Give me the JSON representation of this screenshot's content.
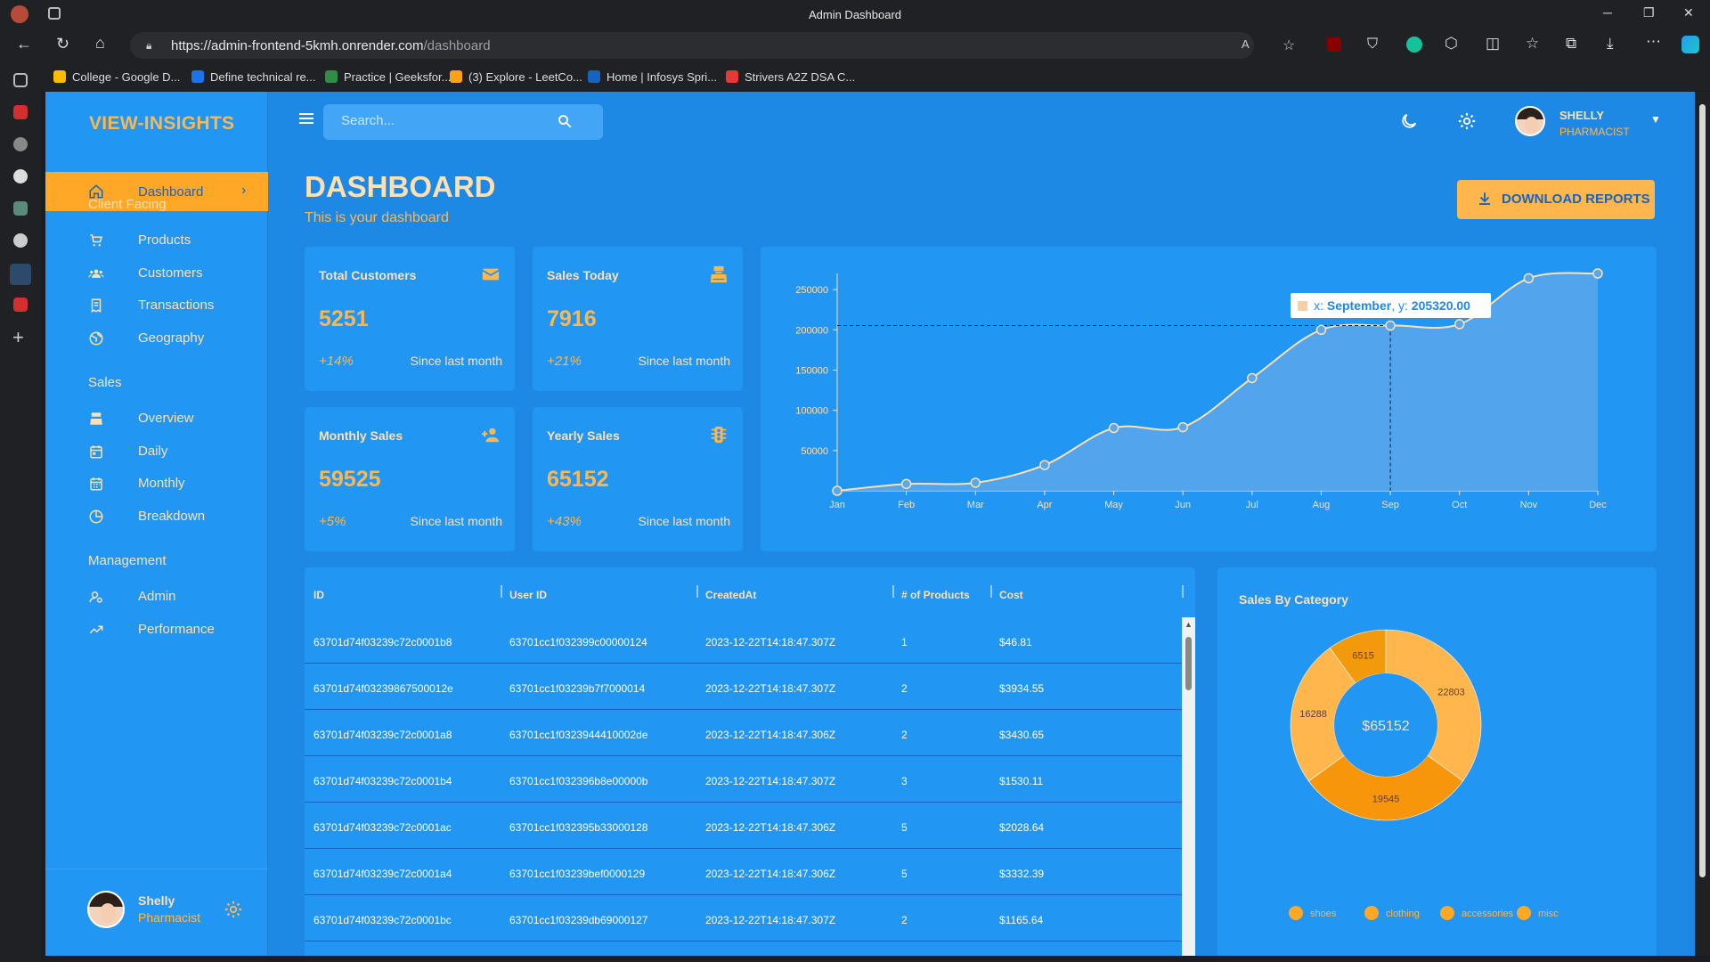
{
  "browser": {
    "window_title": "Admin Dashboard",
    "url_host": "https://admin-frontend-5kmh.onrender.com",
    "url_path": "/dashboard",
    "bookmarks": [
      {
        "label": "College - Google D...",
        "color": "#fbbc04"
      },
      {
        "label": "Define technical re...",
        "color": "#1a73e8"
      },
      {
        "label": "Practice | Geeksfor...",
        "color": "#2f8d46"
      },
      {
        "label": "(3) Explore - LeetCo...",
        "color": "#ffa116"
      },
      {
        "label": "Home | Infosys Spri...",
        "color": "#1565c0"
      },
      {
        "label": "Strivers A2Z DSA C...",
        "color": "#e53935"
      }
    ]
  },
  "sidebar": {
    "brand": "VIEW-INSIGHTS",
    "active": {
      "label": "Dashboard",
      "icon": "home-icon"
    },
    "sections": [
      {
        "title": "Client Facing",
        "items": [
          {
            "label": "Products",
            "icon": "cart-icon"
          },
          {
            "label": "Customers",
            "icon": "groups-icon"
          },
          {
            "label": "Transactions",
            "icon": "receipt-icon"
          },
          {
            "label": "Geography",
            "icon": "globe-icon"
          }
        ]
      },
      {
        "title": "Sales",
        "items": [
          {
            "label": "Overview",
            "icon": "point-of-sale-icon"
          },
          {
            "label": "Daily",
            "icon": "calendar-today-icon"
          },
          {
            "label": "Monthly",
            "icon": "calendar-month-icon"
          },
          {
            "label": "Breakdown",
            "icon": "pie-chart-icon"
          }
        ]
      },
      {
        "title": "Management",
        "items": [
          {
            "label": "Admin",
            "icon": "admin-icon"
          },
          {
            "label": "Performance",
            "icon": "trending-up-icon"
          }
        ]
      }
    ],
    "user": {
      "name": "Shelly",
      "role": "Pharmacist"
    }
  },
  "topbar": {
    "search_placeholder": "Search...",
    "user_name": "SHELLY",
    "user_role": "PHARMACIST"
  },
  "header": {
    "title": "DASHBOARD",
    "subtitle": "This is your dashboard",
    "download_label": "DOWNLOAD REPORTS"
  },
  "stats": [
    {
      "title": "Total Customers",
      "value": "5251",
      "increase": "+14%",
      "since": "Since last month",
      "icon": "email-icon"
    },
    {
      "title": "Sales Today",
      "value": "7916",
      "increase": "+21%",
      "since": "Since last month",
      "icon": "point-of-sale-icon"
    },
    {
      "title": "Monthly Sales",
      "value": "59525",
      "increase": "+5%",
      "since": "Since last month",
      "icon": "person-add-icon"
    },
    {
      "title": "Yearly Sales",
      "value": "65152",
      "increase": "+43%",
      "since": "Since last month",
      "icon": "traffic-icon"
    }
  ],
  "chart_data": [
    {
      "type": "area",
      "x": [
        "Jan",
        "Feb",
        "Mar",
        "Apr",
        "May",
        "Jun",
        "Jul",
        "Aug",
        "Sep",
        "Oct",
        "Nov",
        "Dec"
      ],
      "series": [
        {
          "values": [
            0,
            8500,
            10000,
            32000,
            78000,
            79000,
            140000,
            200000,
            205320,
            207000,
            264000,
            270000
          ]
        }
      ],
      "ylim": [
        0,
        270000
      ],
      "yticks": [
        50000,
        100000,
        150000,
        200000,
        250000
      ],
      "tooltip": {
        "x_label": "x: ",
        "x_value": "September",
        "y_label": ", y: ",
        "y_value": "205320.00"
      },
      "highlight_index": 8,
      "colors": {
        "line": "#ffe0b2",
        "fill": "#5aa7ea"
      }
    },
    {
      "type": "pie",
      "title": "Sales By Category",
      "center_label": "$65152",
      "categories": [
        "shoes",
        "clothing",
        "accessories",
        "misc"
      ],
      "values": [
        6515,
        22803,
        19545,
        16288
      ],
      "colors": [
        "#f29a0c",
        "#ffb74d",
        "#f7960b",
        "#ffb74d"
      ]
    }
  ],
  "table": {
    "headers": [
      "ID",
      "User ID",
      "CreatedAt",
      "# of Products",
      "Cost"
    ],
    "rows": [
      [
        "63701d74f03239c72c0001b8",
        "63701cc1f032399c00000124",
        "2023-12-22T14:18:47.307Z",
        "1",
        "$46.81"
      ],
      [
        "63701d74f03239867500012e",
        "63701cc1f03239b7f7000014",
        "2023-12-22T14:18:47.307Z",
        "2",
        "$3934.55"
      ],
      [
        "63701d74f03239c72c0001a8",
        "63701cc1f0323944410002de",
        "2023-12-22T14:18:47.306Z",
        "2",
        "$3430.65"
      ],
      [
        "63701d74f03239c72c0001b4",
        "63701cc1f032396b8e00000b",
        "2023-12-22T14:18:47.307Z",
        "3",
        "$1530.11"
      ],
      [
        "63701d74f03239c72c0001ac",
        "63701cc1f032395b33000128",
        "2023-12-22T14:18:47.306Z",
        "5",
        "$2028.64"
      ],
      [
        "63701d74f03239c72c0001a4",
        "63701cc1f03239bef0000129",
        "2023-12-22T14:18:47.306Z",
        "5",
        "$3332.39"
      ],
      [
        "63701d74f03239c72c0001bc",
        "63701cc1f03239db69000127",
        "2023-12-22T14:18:47.307Z",
        "2",
        "$1165.64"
      ]
    ]
  }
}
